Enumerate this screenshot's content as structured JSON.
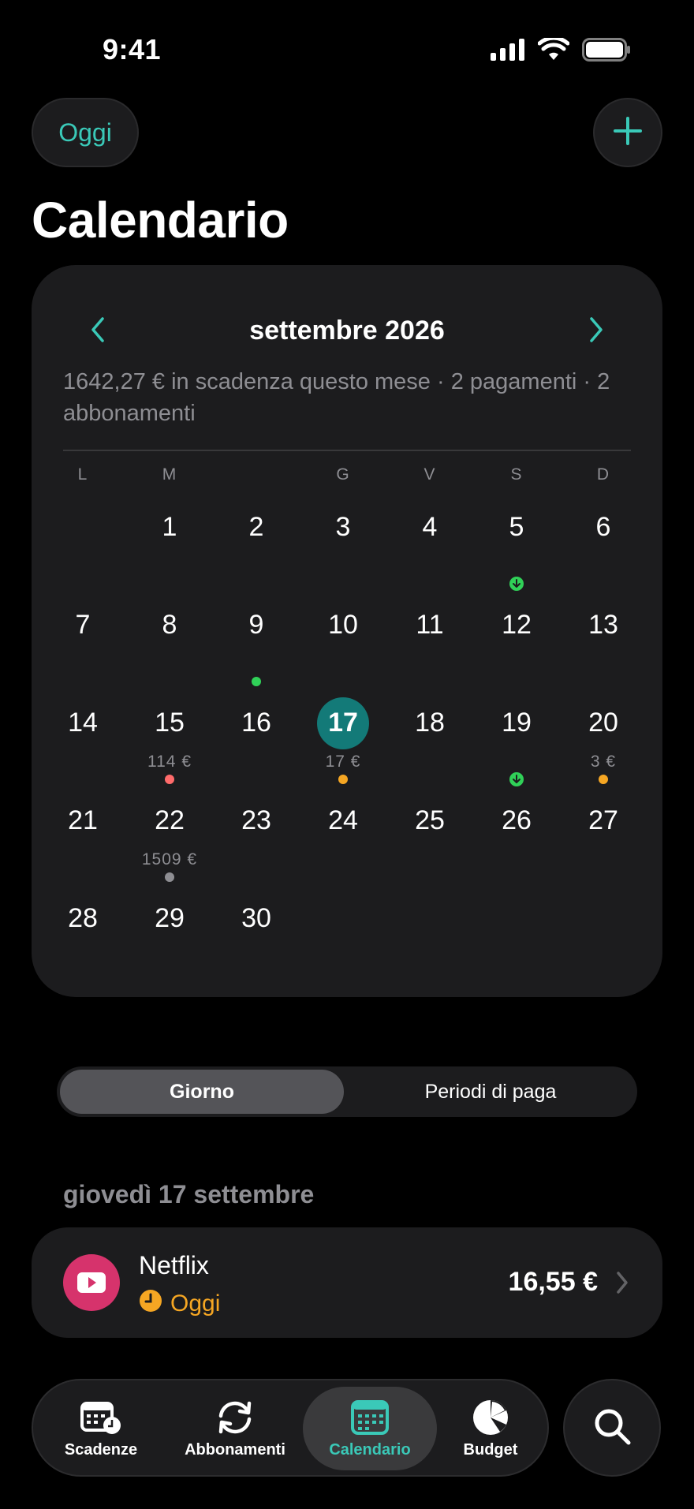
{
  "status_bar": {
    "time": "9:41"
  },
  "header": {
    "today_button": "Oggi",
    "title": "Calendario"
  },
  "calendar": {
    "month_label": "settembre 2026",
    "summary": "1642,27 € in scadenza questo mese · 2 pagamenti · 2 abbonamenti",
    "weekdays": [
      "L",
      "M",
      "",
      "G",
      "V",
      "S",
      "D"
    ],
    "days": [
      {
        "num": "1",
        "col": 1,
        "row": 0
      },
      {
        "num": "2",
        "col": 2,
        "row": 0
      },
      {
        "num": "3",
        "col": 3,
        "row": 0
      },
      {
        "num": "4",
        "col": 4,
        "row": 0
      },
      {
        "num": "5",
        "col": 5,
        "row": 0
      },
      {
        "num": "6",
        "col": 6,
        "row": 0
      },
      {
        "num": "7",
        "col": 0,
        "row": 1
      },
      {
        "num": "8",
        "col": 1,
        "row": 1
      },
      {
        "num": "9",
        "col": 2,
        "row": 1
      },
      {
        "num": "10",
        "col": 3,
        "row": 1
      },
      {
        "num": "11",
        "col": 4,
        "row": 1
      },
      {
        "num": "12",
        "col": 5,
        "row": 1
      },
      {
        "num": "13",
        "col": 6,
        "row": 1
      },
      {
        "num": "14",
        "col": 0,
        "row": 2
      },
      {
        "num": "15",
        "col": 1,
        "row": 2
      },
      {
        "num": "16",
        "col": 2,
        "row": 2
      },
      {
        "num": "17",
        "col": 3,
        "row": 2,
        "today": true
      },
      {
        "num": "18",
        "col": 4,
        "row": 2
      },
      {
        "num": "19",
        "col": 5,
        "row": 2
      },
      {
        "num": "20",
        "col": 6,
        "row": 2
      },
      {
        "num": "21",
        "col": 0,
        "row": 3
      },
      {
        "num": "22",
        "col": 1,
        "row": 3
      },
      {
        "num": "23",
        "col": 2,
        "row": 3
      },
      {
        "num": "24",
        "col": 3,
        "row": 3
      },
      {
        "num": "25",
        "col": 4,
        "row": 3
      },
      {
        "num": "26",
        "col": 5,
        "row": 3
      },
      {
        "num": "27",
        "col": 6,
        "row": 3
      },
      {
        "num": "28",
        "col": 0,
        "row": 4
      },
      {
        "num": "29",
        "col": 1,
        "row": 4
      },
      {
        "num": "30",
        "col": 2,
        "row": 4
      }
    ],
    "markers": [
      {
        "day": "5",
        "type": "income",
        "color": "#30d158"
      },
      {
        "day": "9",
        "type": "dot",
        "color": "#30d158"
      },
      {
        "day": "15",
        "amount": "114 €",
        "type": "dot",
        "color": "#ff6b6b"
      },
      {
        "day": "17",
        "amount": "17 €",
        "type": "dot",
        "color": "#f5a623"
      },
      {
        "day": "19",
        "type": "income",
        "color": "#30d158"
      },
      {
        "day": "20",
        "amount": "3 €",
        "type": "dot",
        "color": "#f5a623"
      },
      {
        "day": "22",
        "amount": "1509 €",
        "type": "dot",
        "color": "#8e8e93"
      }
    ]
  },
  "segmented": {
    "day_label": "Giorno",
    "pay_period_label": "Periodi di paga"
  },
  "selected_date": "giovedì 17 settembre",
  "events": [
    {
      "name": "Netflix",
      "status": "Oggi",
      "amount": "16,55 €",
      "icon": "play-icon",
      "icon_color": "#d6336c",
      "status_color": "#f5a623"
    }
  ],
  "tabs": [
    {
      "label": "Scadenze",
      "icon": "calendar-clock-icon"
    },
    {
      "label": "Abbonamenti",
      "icon": "refresh-icon"
    },
    {
      "label": "Calendario",
      "icon": "calendar-grid-icon",
      "active": true
    },
    {
      "label": "Budget",
      "icon": "pie-chart-icon"
    }
  ],
  "colors": {
    "accent": "#3ac9b8",
    "today": "#137a78",
    "background": "#000000",
    "card": "#1c1c1e"
  }
}
